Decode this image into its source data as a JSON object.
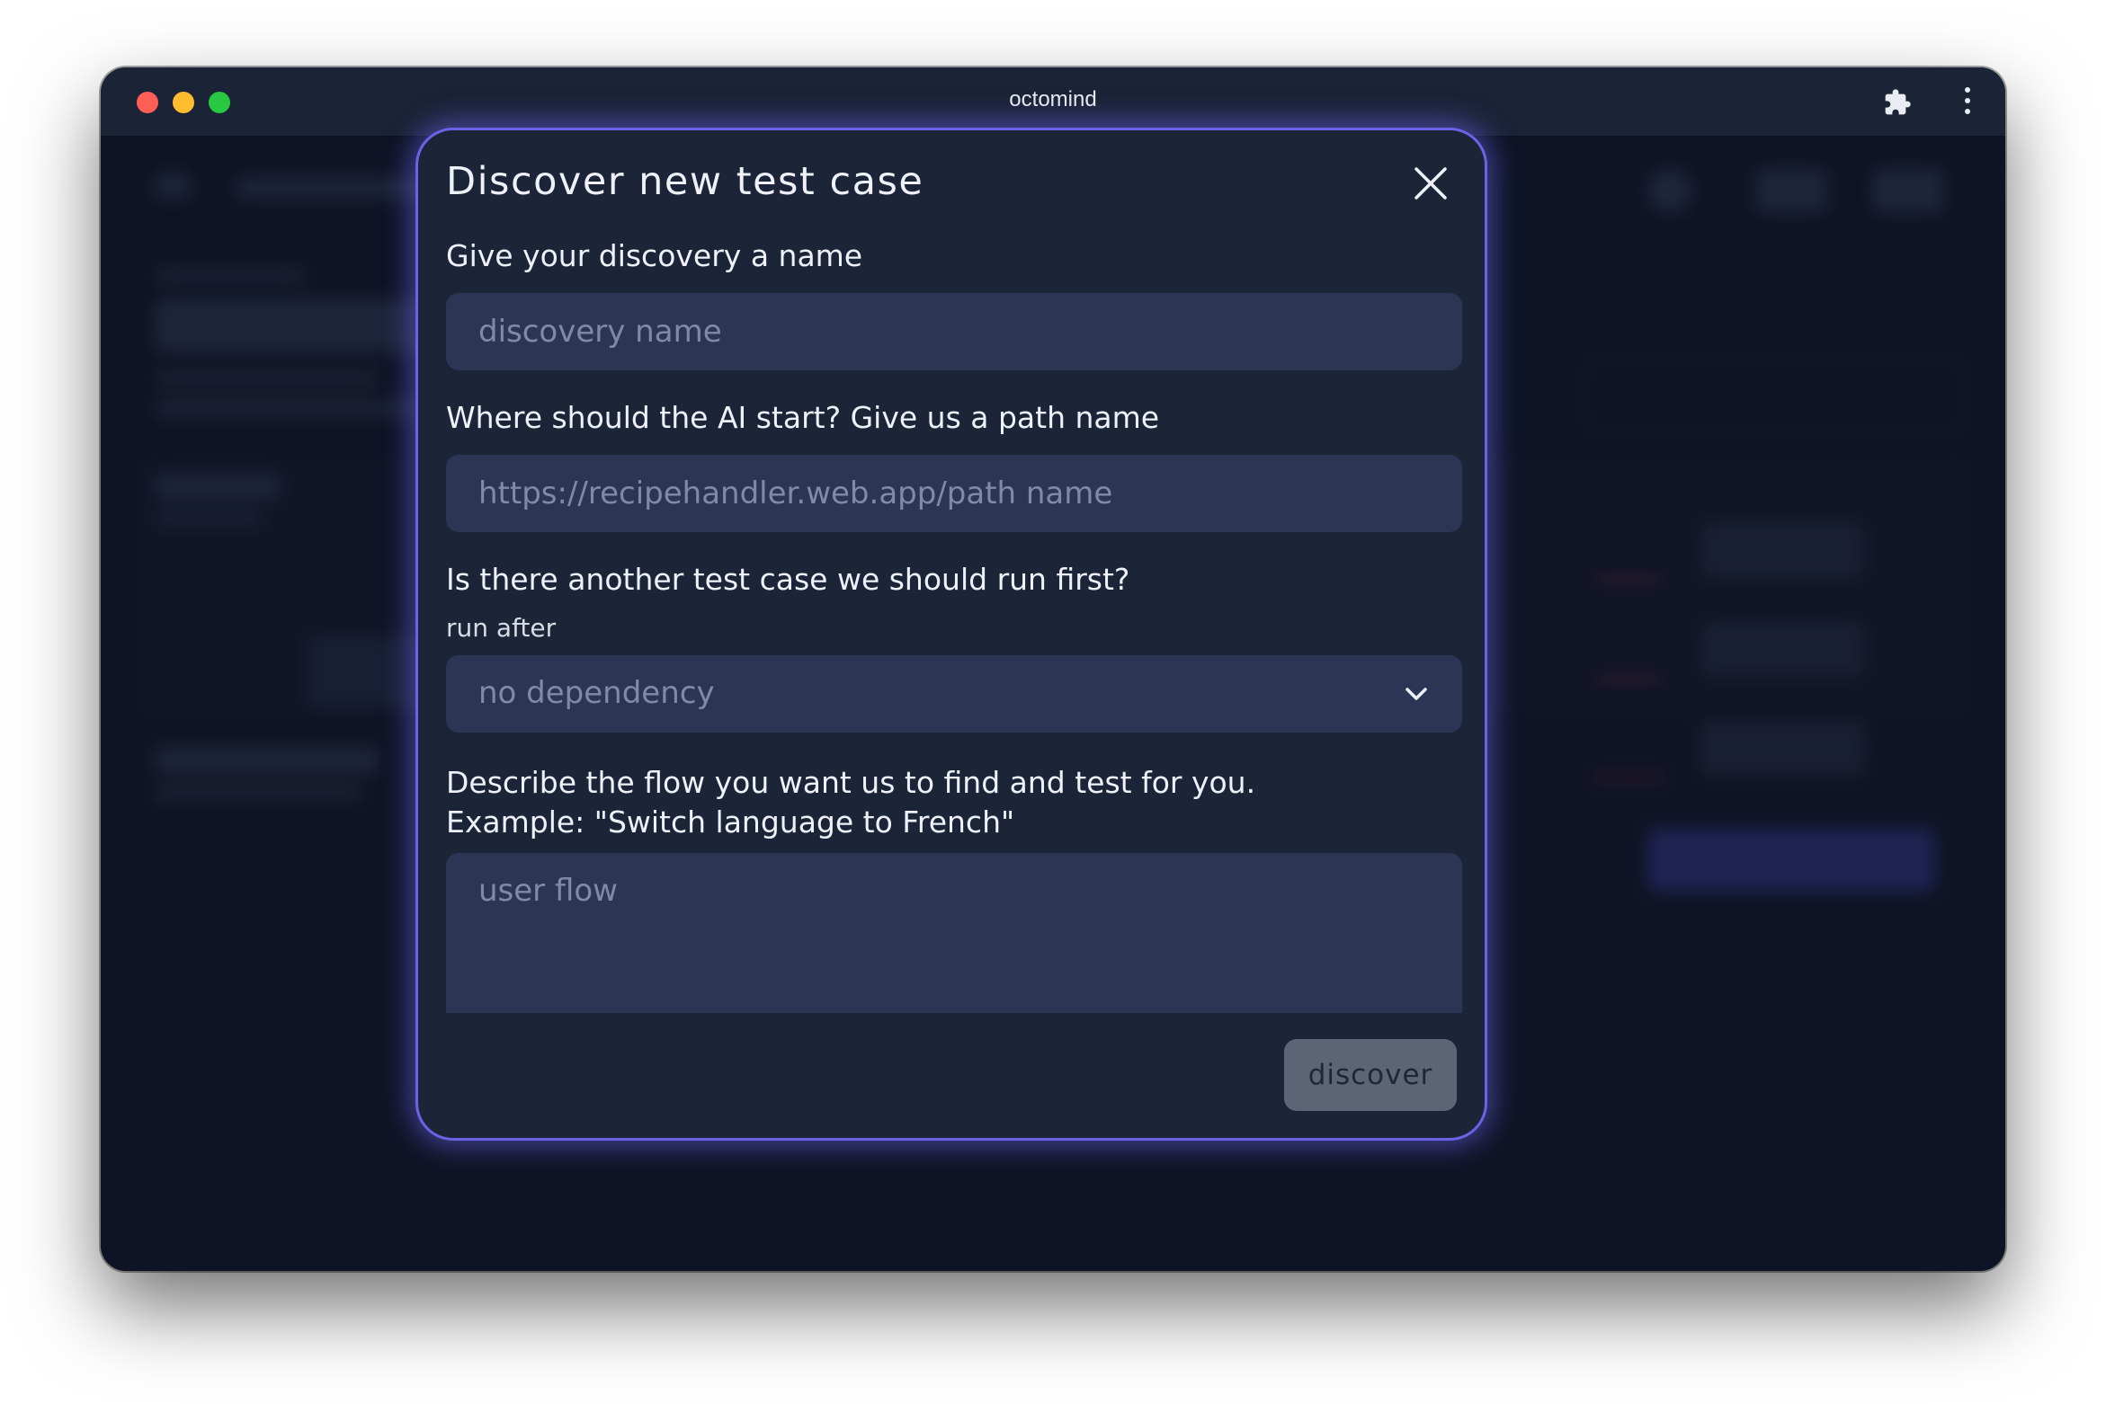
{
  "window": {
    "title": "octomind"
  },
  "modal": {
    "title": "Discover new test case",
    "name_label": "Give your discovery a name",
    "name_placeholder": "discovery name",
    "name_value": "",
    "path_label": "Where should the AI start? Give us a path name",
    "path_placeholder": "https://recipehandler.web.app/path name",
    "path_value": "",
    "dependency_label": "Is there another test case we should run first?",
    "run_after_label": "run after",
    "dependency_value": "no dependency",
    "flow_label_line1": "Describe the flow you want us to find and test for you.",
    "flow_label_line2": "Example: \"Switch language to French\"",
    "flow_placeholder": "user flow",
    "flow_value": "",
    "discover_label": "discover"
  },
  "icons": {
    "close": "close-icon",
    "chevron": "chevron-down-icon",
    "extensions": "puzzle-icon",
    "menu": "more-vertical-icon"
  },
  "colors": {
    "accent_border": "#6b63e6",
    "modal_bg": "#1c2438",
    "field_bg": "#2a3654",
    "button_bg": "#5c6476"
  }
}
